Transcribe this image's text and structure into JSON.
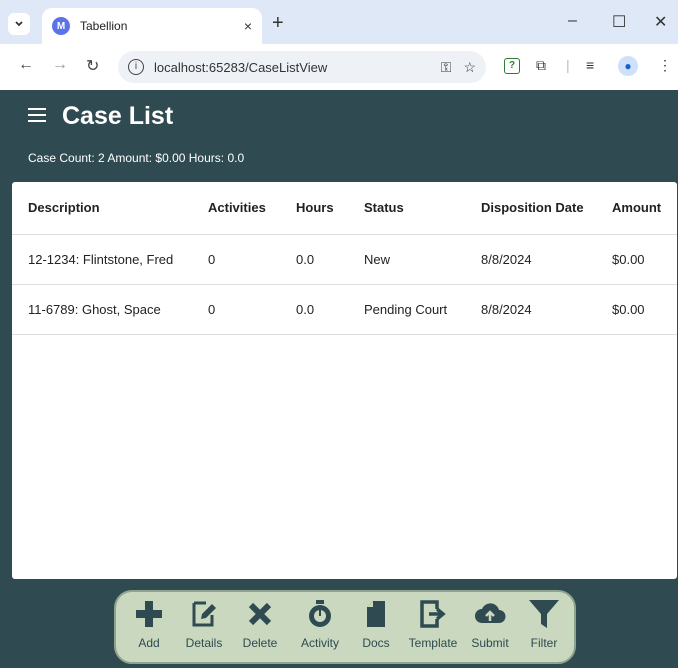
{
  "browser": {
    "tab_title": "Tabellion",
    "tab_close": "×",
    "new_tab": "+",
    "url": "localhost:65283/CaseListView",
    "icons": [
      "chevron-down-icon",
      "back-arrow-icon",
      "forward-arrow-icon",
      "reload-icon",
      "key-icon",
      "star-icon",
      "extension-icon",
      "puzzle-icon",
      "media-icon",
      "profile-icon",
      "more-icon"
    ]
  },
  "app": {
    "title": "Case List",
    "summary": "Case Count: 2 Amount: $0.00 Hours: 0.0",
    "background": "#2f4b51"
  },
  "table": {
    "headers": [
      "Description",
      "Activities",
      "Hours",
      "Status",
      "Disposition Date",
      "Amount"
    ],
    "rows": [
      [
        "12-1234: Flintstone, Fred",
        "0",
        "0.0",
        "New",
        "8/8/2024",
        "$0.00"
      ],
      [
        "11-6789: Ghost, Space",
        "0",
        "0.0",
        "Pending Court",
        "8/8/2024",
        "$0.00"
      ]
    ]
  },
  "footer": {
    "buttons": [
      {
        "label": "Add",
        "icon": "plus-icon"
      },
      {
        "label": "Details",
        "icon": "edit-icon"
      },
      {
        "label": "Delete",
        "icon": "x-icon"
      },
      {
        "label": "Activity",
        "icon": "stopwatch-icon"
      },
      {
        "label": "Docs",
        "icon": "document-icon"
      },
      {
        "label": "Template",
        "icon": "export-icon"
      },
      {
        "label": "Submit",
        "icon": "cloud-upload-icon"
      },
      {
        "label": "Filter",
        "icon": "filter-icon"
      }
    ]
  }
}
